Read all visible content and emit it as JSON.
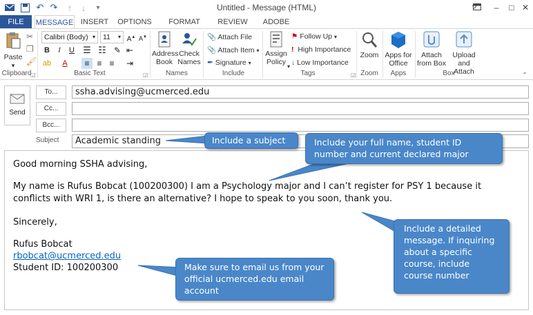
{
  "window": {
    "title": "Untitled - Message (HTML)",
    "controls": [
      "?",
      "□",
      "–",
      "□",
      "✕"
    ]
  },
  "tabs": [
    "FILE",
    "MESSAGE",
    "INSERT",
    "OPTIONS",
    "FORMAT TEXT",
    "REVIEW",
    "ADOBE PDF"
  ],
  "ribbon": {
    "clipboard": {
      "paste": "Paste",
      "label": "Clipboard"
    },
    "basic_text": {
      "font": "Calibri (Body)",
      "size": "11",
      "label": "Basic Text"
    },
    "names": {
      "address_book": "Address Book",
      "check_names": "Check Names",
      "label": "Names"
    },
    "include": {
      "attach_file": "Attach File",
      "attach_item": "Attach Item",
      "signature": "Signature",
      "label": "Include"
    },
    "tags": {
      "assign_policy": "Assign Policy",
      "follow_up": "Follow Up",
      "high_importance": "High Importance",
      "low_importance": "Low Importance",
      "label": "Tags"
    },
    "zoom": {
      "zoom": "Zoom",
      "label": "Zoom"
    },
    "apps": {
      "apps_for_office": "Apps for Office",
      "label": "Apps"
    },
    "box": {
      "attach_from_box": "Attach from Box",
      "upload_and_attach": "Upload and Attach",
      "label": "Box"
    }
  },
  "header": {
    "send": "Send",
    "to_label": "To...",
    "cc_label": "Cc...",
    "bcc_label": "Bcc...",
    "subject_label": "Subject",
    "to_value": "ssha.advising@ucmerced.edu",
    "cc_value": "",
    "bcc_value": "",
    "subject_value": "Academic standing"
  },
  "body": {
    "greeting": "Good morning SSHA advising,",
    "line1": "My name is Rufus Bobcat (100200300) I am a Psychology major and I can’t register for PSY 1 because it",
    "line2": "conflicts with WRI 1, is there an alternative? I hope to speak to you soon, thank you.",
    "closing": "Sincerely,",
    "name": "Rufus Bobcat",
    "email": "rbobcat@ucmerced.edu",
    "student_id": "Student ID: 100200300"
  },
  "callouts": {
    "subject": "Include a subject",
    "full_name": "Include your full name, student ID number and current declared major",
    "detailed": "Include a detailed message. If inquiring about a specific course, include course number",
    "official_email": "Make sure to email us from your official ucmerced.edu email account"
  },
  "colors": {
    "accent": "#2b579a",
    "callout": "#4a87c9",
    "link": "#0563c1"
  }
}
